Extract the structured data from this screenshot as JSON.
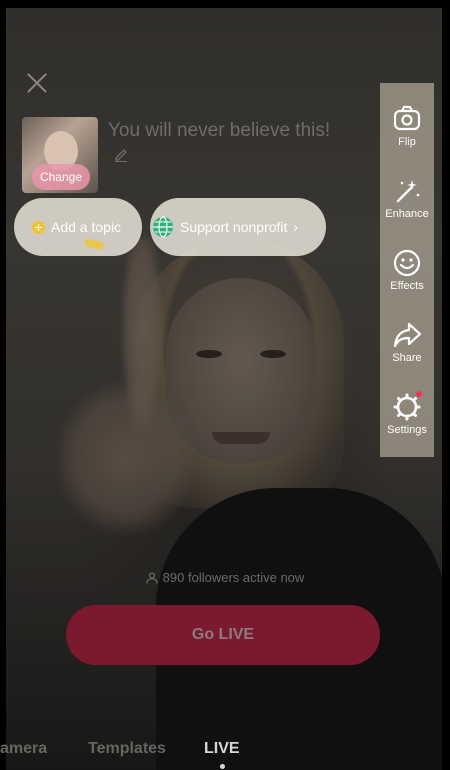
{
  "header": {
    "close_icon": "close-icon",
    "title_placeholder": "You will never believe this!",
    "cover_change_label": "Change"
  },
  "chips": {
    "topic_label": "Add a topic",
    "nonprofit_label": "Support nonprofit",
    "nonprofit_chevron": "›"
  },
  "sidebar": {
    "items": [
      {
        "label": "Flip",
        "icon": "flip-camera-icon"
      },
      {
        "label": "Enhance",
        "icon": "magic-wand-icon"
      },
      {
        "label": "Effects",
        "icon": "smiley-face-icon"
      },
      {
        "label": "Share",
        "icon": "share-arrow-icon"
      },
      {
        "label": "Settings",
        "icon": "gear-icon",
        "has_notification": true
      }
    ]
  },
  "status": {
    "followers_active": "890 followers active now"
  },
  "actions": {
    "go_live_label": "Go LIVE"
  },
  "modes": {
    "items": [
      "amera",
      "Templates",
      "LIVE"
    ],
    "selected": "LIVE"
  },
  "colors": {
    "go_live_button": "#7b1a2e",
    "notification_dot": "#fe2c55",
    "topic_icon": "#f2c230"
  }
}
